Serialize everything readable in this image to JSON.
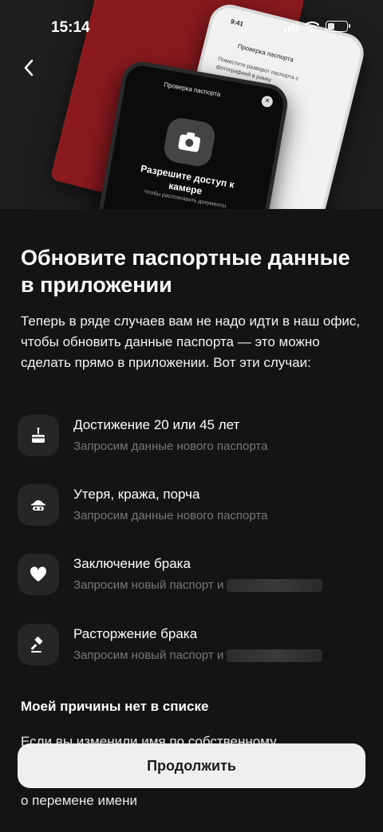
{
  "status": {
    "time": "15:14"
  },
  "hero": {
    "white_phone": {
      "time": "9:41",
      "title": "Проверка паспорта",
      "text": "Поместите разворот паспорта с фотографией в рамку"
    },
    "black_phone": {
      "title": "Проверка паспорта",
      "heading": "Разрешите доступ к камере",
      "text": "Чтобы распознавать документы"
    }
  },
  "page": {
    "title": "Обновите паспортные данные в приложении",
    "intro": "Теперь в ряде случаев вам не надо идти в наш офис, чтобы обновить данные паспорта — это можно сделать прямо в приложении. Вот эти случаи:"
  },
  "reasons": [
    {
      "icon": "cake-icon",
      "title": "Достижение 20 или 45 лет",
      "subtitle": "Запросим данные нового паспорта"
    },
    {
      "icon": "thief-icon",
      "title": "Утеря, кража, порча",
      "subtitle": "Запросим данные нового паспорта"
    },
    {
      "icon": "heart-icon",
      "title": "Заключение брака",
      "subtitle": "Запросим новый паспорт и"
    },
    {
      "icon": "gavel-icon",
      "title": "Расторжение брака",
      "subtitle": "Запросим новый паспорт и"
    }
  ],
  "no_reason": {
    "title": "Моей причины нет в списке",
    "text": "Если вы изменили имя по собственному",
    "text2": "о перемене имени"
  },
  "button": {
    "continue": "Продолжить"
  }
}
